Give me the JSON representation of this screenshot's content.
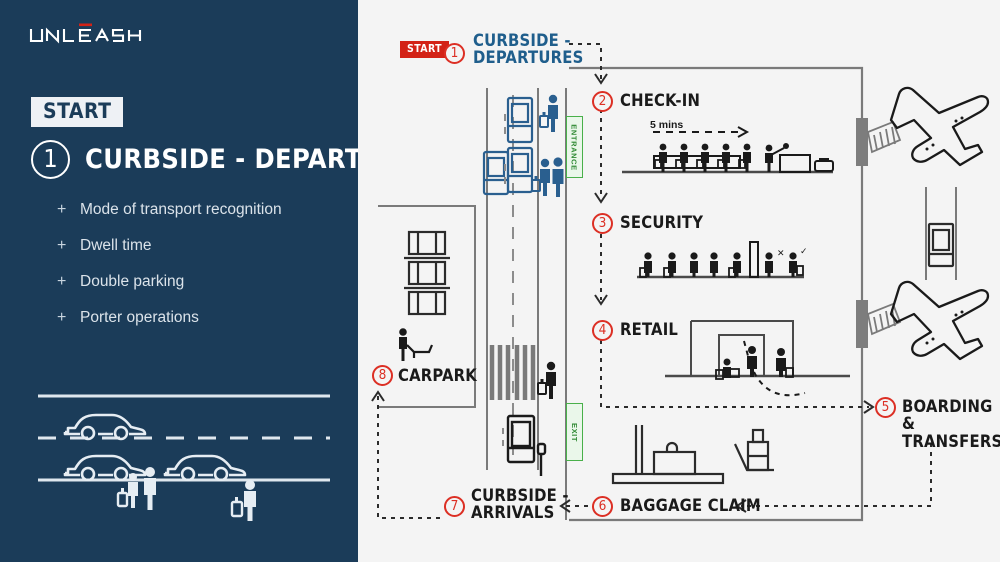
{
  "brand": {
    "name": "UNLEASH",
    "accent_color": "#d32216"
  },
  "theme": {
    "panel_bg": "#1b3c59",
    "diagram_bg": "#f4f4f4",
    "red": "#dc2f24",
    "blue_accent": "#1f5e8c",
    "green": "#49b04a",
    "dark": "#1a1a1a"
  },
  "left_panel": {
    "start_label": "START",
    "step_number": "1",
    "step_title": "CURBSIDE - DEPARTURES",
    "bullets": [
      {
        "marker": "+",
        "label": "Mode of transport recognition"
      },
      {
        "marker": "+",
        "label": "Dwell time"
      },
      {
        "marker": "+",
        "label": "Double parking"
      },
      {
        "marker": "+",
        "label": "Porter operations"
      }
    ]
  },
  "diagram": {
    "start_chip": "START",
    "annotation_time": "5 mins",
    "doors": [
      {
        "id": "entrance",
        "label": "ENTRANCE"
      },
      {
        "id": "exit",
        "label": "EXIT"
      }
    ],
    "steps": [
      {
        "number": "1",
        "label": "CURBSIDE -\nDEPARTURES",
        "color": "blue"
      },
      {
        "number": "2",
        "label": "CHECK-IN",
        "color": "dark"
      },
      {
        "number": "3",
        "label": "SECURITY",
        "color": "dark"
      },
      {
        "number": "4",
        "label": "RETAIL",
        "color": "dark"
      },
      {
        "number": "5",
        "label": "BOARDING &\nTRANSFERS",
        "color": "dark"
      },
      {
        "number": "6",
        "label": "BAGGAGE CLAIM",
        "color": "dark"
      },
      {
        "number": "7",
        "label": "CURBSIDE -\nARRIVALS",
        "color": "dark"
      },
      {
        "number": "8",
        "label": "CARPARK",
        "color": "dark"
      }
    ],
    "scenes": {
      "check_in": {
        "queue_people": 5,
        "staff": 1,
        "counters": 1
      },
      "security": {
        "queue_people": 5,
        "scanner_gates": 1,
        "cleared_people": 2,
        "marks": [
          "x",
          "check"
        ]
      },
      "retail": {
        "shoppers": 3,
        "store_fronts": 2
      },
      "baggage_claim": {
        "belts": 1,
        "suitcases": 1,
        "trolleys": 1
      },
      "carpark": {
        "parked_cars": 3,
        "attendant": 1
      },
      "apron": {
        "aircraft": 2,
        "jet_bridges": 2,
        "service_vehicles": 1
      },
      "curbside": {
        "cars": 3,
        "travellers": 3
      }
    }
  }
}
